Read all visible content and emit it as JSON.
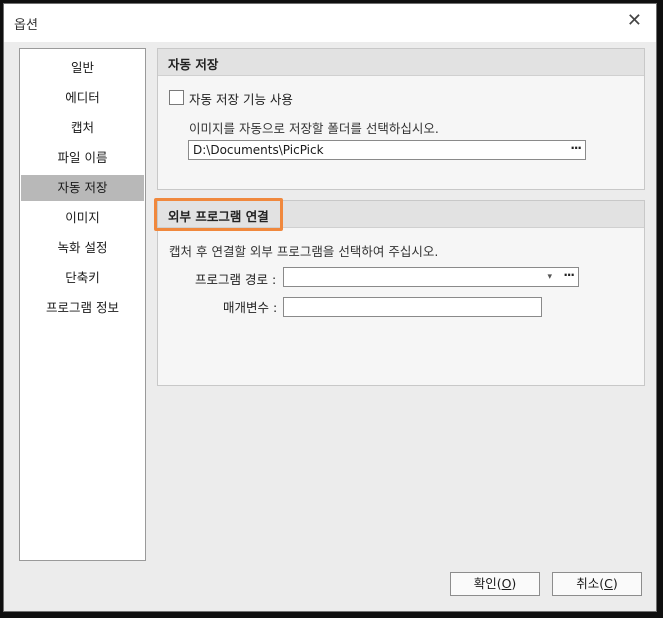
{
  "window": {
    "title": "옵션",
    "close_glyph": "✕"
  },
  "sidebar": {
    "items": [
      {
        "label": "일반"
      },
      {
        "label": "에디터"
      },
      {
        "label": "캡처"
      },
      {
        "label": "파일 이름"
      },
      {
        "label": "자동 저장",
        "selected": true
      },
      {
        "label": "이미지"
      },
      {
        "label": "녹화 설정"
      },
      {
        "label": "단축키"
      },
      {
        "label": "프로그램 정보"
      }
    ]
  },
  "autosave": {
    "header": "자동 저장",
    "checkbox_label": "자동 저장 기능 사용",
    "checkbox_checked": false,
    "description": "이미지를 자동으로 저장할 폴더를 선택하십시오.",
    "folder_path": "D:\\Documents\\PicPick",
    "browse_label": "···"
  },
  "external": {
    "header": "외부 프로그램 연결",
    "description": "캡처 후 연결할 외부 프로그램을 선택하여 주십시오.",
    "program_path_label": "프로그램 경로 :",
    "program_path_value": "",
    "dropdown_glyph": "▾",
    "browse_label": "···",
    "params_label": "매개변수 :",
    "params_value": ""
  },
  "footer": {
    "ok_text": "확인(",
    "ok_key": "O",
    "ok_close": ")",
    "cancel_text": "취소(",
    "cancel_key": "C",
    "cancel_close": ")"
  },
  "colors": {
    "highlight": "#f0883d",
    "selected_item": "#b8b8b8"
  }
}
